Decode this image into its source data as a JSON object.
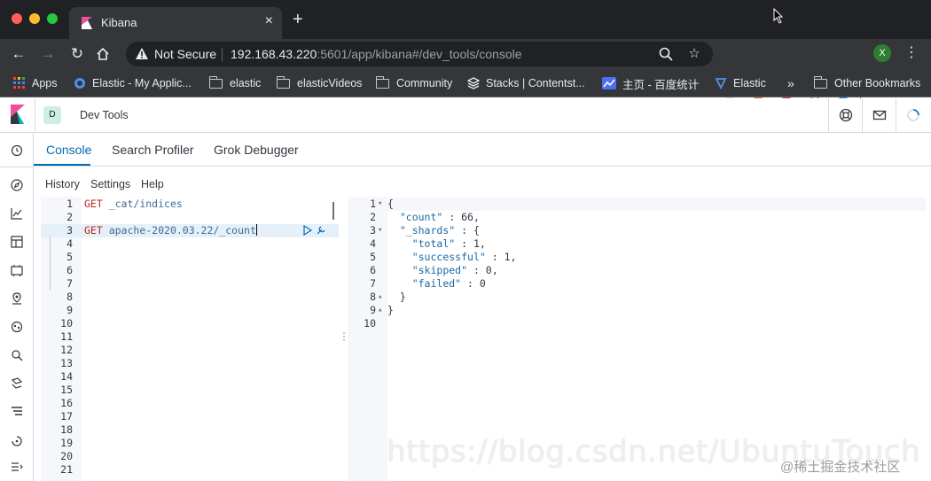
{
  "browser": {
    "tab_title": "Kibana",
    "tab_close": "×",
    "new_tab": "+",
    "security_label": "Not Secure",
    "url_host": "192.168.43.220",
    "url_rest": ":5601/app/kibana#/dev_tools/console",
    "profile_initial": "X",
    "bookmarks": [
      {
        "label": "Apps",
        "icon": "apps-grid-icon"
      },
      {
        "label": "Elastic - My Applic...",
        "icon": "elastic-icon"
      },
      {
        "label": "elastic",
        "icon": "folder-icon"
      },
      {
        "label": "elasticVideos",
        "icon": "folder-icon"
      },
      {
        "label": "Community",
        "icon": "folder-icon"
      },
      {
        "label": "Stacks | Contentst...",
        "icon": "stack-icon"
      },
      {
        "label": "主页 - 百度统计",
        "icon": "chart-icon"
      },
      {
        "label": "Elastic",
        "icon": "elastic-icon"
      },
      {
        "label": "»",
        "icon": "overflow-chevron-icon"
      },
      {
        "label": "Other Bookmarks",
        "icon": "folder-icon"
      }
    ]
  },
  "kibana": {
    "space_initial": "D",
    "breadcrumb": "Dev Tools",
    "tabs": [
      {
        "label": "Console",
        "active": true
      },
      {
        "label": "Search Profiler",
        "active": false
      },
      {
        "label": "Grok Debugger",
        "active": false
      }
    ],
    "submenu": [
      "History",
      "Settings",
      "Help"
    ],
    "editor_lines": [
      {
        "n": "1",
        "method": "GET",
        "path": " _cat/indices"
      },
      {
        "n": "2",
        "method": "",
        "path": ""
      },
      {
        "n": "3",
        "method": "GET",
        "path": " apache-2020.03.22/_count"
      },
      {
        "n": "4",
        "method": "",
        "path": ""
      },
      {
        "n": "5",
        "method": "",
        "path": ""
      },
      {
        "n": "6",
        "method": "",
        "path": ""
      },
      {
        "n": "7",
        "method": "",
        "path": ""
      },
      {
        "n": "8",
        "method": "",
        "path": ""
      },
      {
        "n": "9",
        "method": "",
        "path": ""
      },
      {
        "n": "10",
        "method": "",
        "path": ""
      },
      {
        "n": "11",
        "method": "",
        "path": ""
      },
      {
        "n": "12",
        "method": "",
        "path": ""
      },
      {
        "n": "13",
        "method": "",
        "path": ""
      },
      {
        "n": "14",
        "method": "",
        "path": ""
      },
      {
        "n": "15",
        "method": "",
        "path": ""
      },
      {
        "n": "16",
        "method": "",
        "path": ""
      },
      {
        "n": "17",
        "method": "",
        "path": ""
      },
      {
        "n": "18",
        "method": "",
        "path": ""
      },
      {
        "n": "19",
        "method": "",
        "path": ""
      },
      {
        "n": "20",
        "method": "",
        "path": ""
      },
      {
        "n": "21",
        "method": "",
        "path": ""
      }
    ],
    "output_lines": [
      {
        "n": "1",
        "fold": "▾",
        "text": "{"
      },
      {
        "n": "2",
        "fold": "",
        "text": "  \"count\" : 66,"
      },
      {
        "n": "3",
        "fold": "▾",
        "text": "  \"_shards\" : {"
      },
      {
        "n": "4",
        "fold": "",
        "text": "    \"total\" : 1,"
      },
      {
        "n": "5",
        "fold": "",
        "text": "    \"successful\" : 1,"
      },
      {
        "n": "6",
        "fold": "",
        "text": "    \"skipped\" : 0,"
      },
      {
        "n": "7",
        "fold": "",
        "text": "    \"failed\" : 0"
      },
      {
        "n": "8",
        "fold": "▴",
        "text": "  }"
      },
      {
        "n": "9",
        "fold": "▴",
        "text": "}"
      },
      {
        "n": "10",
        "fold": "",
        "text": ""
      }
    ]
  },
  "overlay": {
    "watermark": "https://blog.csdn.net/UbuntuTouch",
    "credit": "@稀土掘金技术社区"
  },
  "colors": {
    "accent": "#006bb4",
    "method": "#bd271e",
    "browser_dark": "#202124"
  }
}
